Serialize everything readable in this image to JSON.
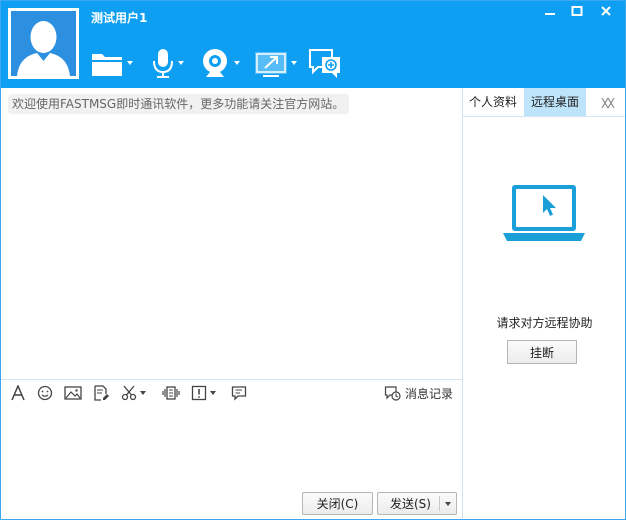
{
  "window": {
    "username": "测试用户1",
    "controls": {
      "minimize": "minimize-icon",
      "maximize": "maximize-icon",
      "close": "close-icon"
    }
  },
  "toolbar": {
    "items": [
      {
        "icon": "folder-icon",
        "has_dropdown": true
      },
      {
        "icon": "microphone-icon",
        "has_dropdown": true
      },
      {
        "icon": "webcam-icon",
        "has_dropdown": true
      },
      {
        "icon": "remote-desktop-icon",
        "has_dropdown": true,
        "active": true
      },
      {
        "icon": "group-chat-add-icon",
        "has_dropdown": false
      }
    ]
  },
  "chat": {
    "notice": "欢迎使用FASTMSG即时通讯软件，更多功能请关注官方网站。",
    "tools": [
      "font-icon",
      "emoji-icon",
      "image-icon",
      "file-edit-icon",
      "screenshot-icon",
      "shake-icon",
      "alert-icon",
      "quick-reply-icon"
    ],
    "history_label": "消息记录",
    "close_button": "关闭(C)",
    "send_button": "发送(S)"
  },
  "side_panel": {
    "tabs": [
      {
        "label": "个人资料",
        "active": false
      },
      {
        "label": "远程桌面",
        "active": true
      }
    ],
    "request_text": "请求对方远程协助",
    "hangup_button": "挂断"
  },
  "colors": {
    "header_bg": "#0e9ff2",
    "accent": "#1a9fd8",
    "active_tab": "#bde4fa"
  }
}
